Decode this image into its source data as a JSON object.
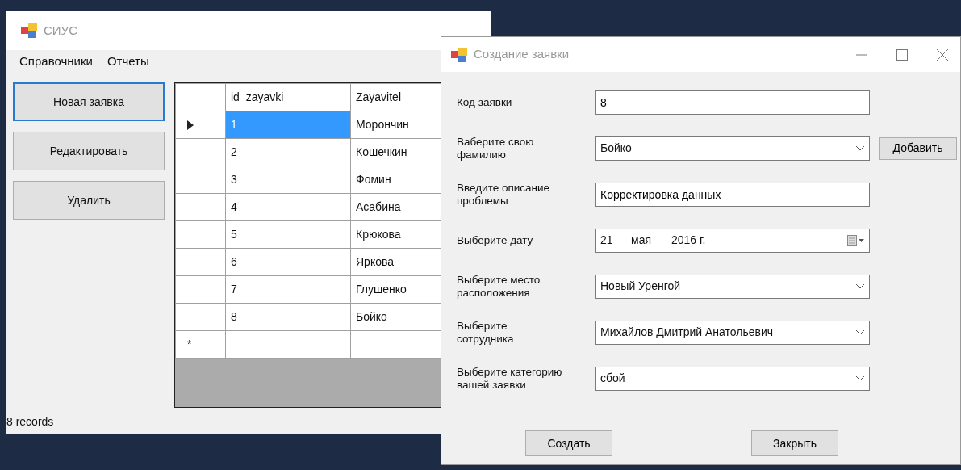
{
  "main_window": {
    "title": "СИУС",
    "menu": [
      "Справочники",
      "Отчеты"
    ],
    "buttons": [
      {
        "label": "Новая заявка",
        "focused": true
      },
      {
        "label": "Редактировать",
        "focused": false
      },
      {
        "label": "Удалить",
        "focused": false
      }
    ],
    "grid": {
      "columns": [
        "id_zayavki",
        "Zayavitel"
      ],
      "rows": [
        {
          "cells": [
            "1",
            "Морончин"
          ],
          "selected": true
        },
        {
          "cells": [
            "2",
            "Кошечкин"
          ],
          "selected": false
        },
        {
          "cells": [
            "3",
            "Фомин"
          ],
          "selected": false
        },
        {
          "cells": [
            "4",
            "Асабина"
          ],
          "selected": false
        },
        {
          "cells": [
            "5",
            "Крюкова"
          ],
          "selected": false
        },
        {
          "cells": [
            "6",
            "Яркова"
          ],
          "selected": false
        },
        {
          "cells": [
            "7",
            "Глушенко"
          ],
          "selected": false
        },
        {
          "cells": [
            "8",
            "Бойко"
          ],
          "selected": false
        }
      ],
      "new_row_marker": "*"
    },
    "status_bar": "8 records"
  },
  "dialog": {
    "title": "Создание заявки",
    "fields": [
      {
        "kind": "text",
        "label": "Код заявки",
        "value": "8"
      },
      {
        "kind": "combo",
        "label": "Ваберите свою фамилию",
        "value": "Бойко",
        "button": "Добавить"
      },
      {
        "kind": "text",
        "label": "Введите описание проблемы",
        "value": "Корректировка данных"
      },
      {
        "kind": "date",
        "label": "Выберите дату",
        "parts": [
          "21",
          "мая",
          "2016 г."
        ]
      },
      {
        "kind": "combo",
        "label": "Выберите место  расположения",
        "value": "Новый Уренгой"
      },
      {
        "kind": "combo",
        "label": "Выберите сотрудника",
        "value": "Михайлов Дмитрий Анатольевич"
      },
      {
        "kind": "combo",
        "label": "Выберите категорию вашей заявки",
        "value": "сбой"
      }
    ],
    "buttons": [
      "Создать",
      "Закрыть"
    ]
  }
}
